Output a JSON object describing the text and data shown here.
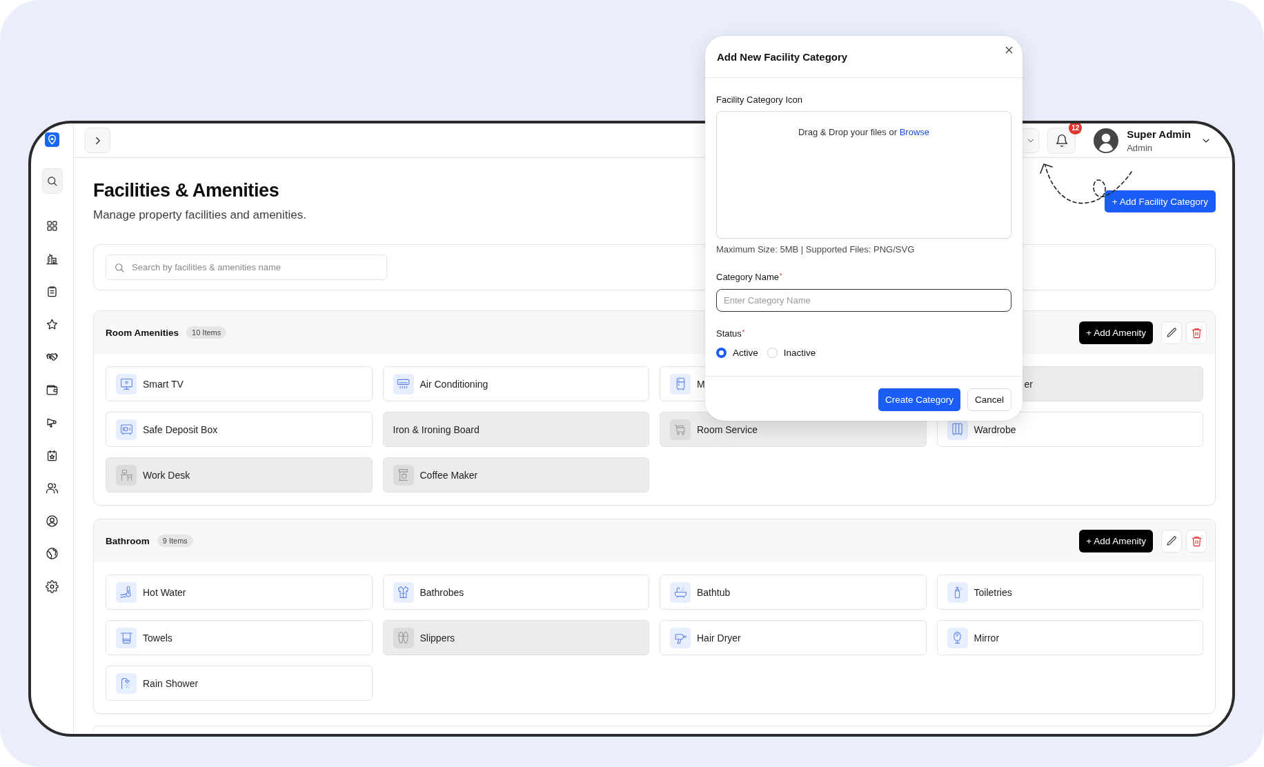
{
  "top_bar": {
    "notification_count": "12",
    "user": {
      "name": "Super Admin",
      "role": "Admin"
    }
  },
  "page": {
    "title": "Facilities & Amenities",
    "subtitle": "Manage property facilities and amenities.",
    "add_button": "+ Add Facility Category"
  },
  "search": {
    "placeholder": "Search by facilities & amenities name"
  },
  "sections": [
    {
      "title": "Room Amenities",
      "count": "10 Items",
      "add_button": "+ Add Amenity",
      "items": [
        {
          "label": "Smart TV",
          "kind": "icon",
          "active": true
        },
        {
          "label": "Air Conditioning",
          "kind": "icon",
          "active": true
        },
        {
          "label": "M",
          "kind": "icon",
          "active": true
        },
        {
          "label": "er",
          "kind": "plain",
          "active": false
        },
        {
          "label": "Safe Deposit Box",
          "kind": "icon",
          "active": true
        },
        {
          "label": "Iron & Ironing Board",
          "kind": "plain",
          "active": false
        },
        {
          "label": "Room Service",
          "kind": "icon",
          "active": false
        },
        {
          "label": "Wardrobe",
          "kind": "icon",
          "active": true
        },
        {
          "label": "Work Desk",
          "kind": "icon",
          "active": false
        },
        {
          "label": "Coffee Maker",
          "kind": "icon",
          "active": false
        }
      ]
    },
    {
      "title": "Bathroom",
      "count": "9 Items",
      "add_button": "+ Add Amenity",
      "items": [
        {
          "label": "Hot Water",
          "kind": "icon",
          "active": true
        },
        {
          "label": "Bathrobes",
          "kind": "icon",
          "active": true
        },
        {
          "label": "Bathtub",
          "kind": "icon",
          "active": true
        },
        {
          "label": "Toiletries",
          "kind": "icon",
          "active": true
        },
        {
          "label": "Towels",
          "kind": "icon",
          "active": true
        },
        {
          "label": "Slippers",
          "kind": "icon",
          "active": false
        },
        {
          "label": "Hair Dryer",
          "kind": "icon",
          "active": true
        },
        {
          "label": "Mirror",
          "kind": "icon",
          "active": true
        },
        {
          "label": "Rain Shower",
          "kind": "icon",
          "active": true
        }
      ]
    }
  ],
  "modal": {
    "title": "Add New Facility Category",
    "icon_label": "Facility Category Icon",
    "dropzone": {
      "text": "Drag & Drop your files or",
      "link": "Browse"
    },
    "hint": "Maximum Size: 5MB | Supported Files: PNG/SVG",
    "name_label": "Category Name$^{*}$",
    "name_placeholder": "Enter Category Name",
    "status_label": "Status$^{*}$",
    "status_options": [
      {
        "label": "Active",
        "selected": true
      },
      {
        "label": "Inactive",
        "selected": false
      }
    ],
    "buttons": [
      {
        "label": "Create Category",
        "kind": "primary"
      },
      {
        "label": "Cancel",
        "kind": "secondary"
      }
    ]
  }
}
